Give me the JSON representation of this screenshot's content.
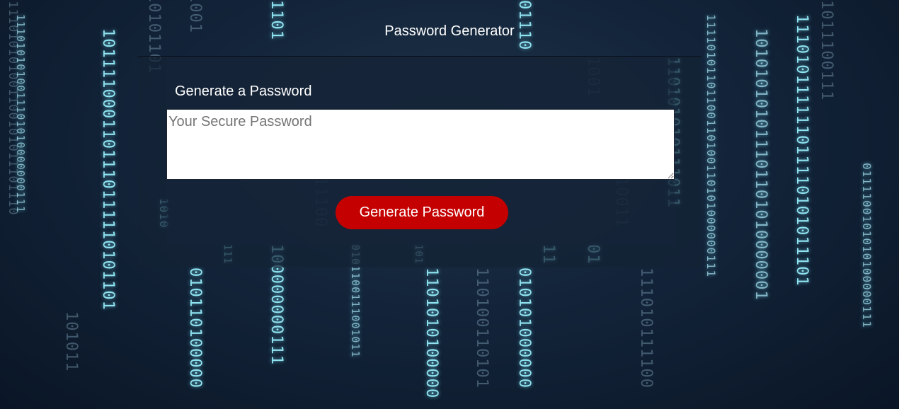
{
  "header": {
    "title": "Password Generator"
  },
  "card": {
    "heading": "Generate a Password",
    "password_field": {
      "value": "",
      "placeholder": "Your Secure Password"
    },
    "generate_button_label": "Generate Password"
  },
  "colors": {
    "button": "#c50000",
    "background": "#13243a",
    "binary_glow": "#8fe3f0"
  }
}
